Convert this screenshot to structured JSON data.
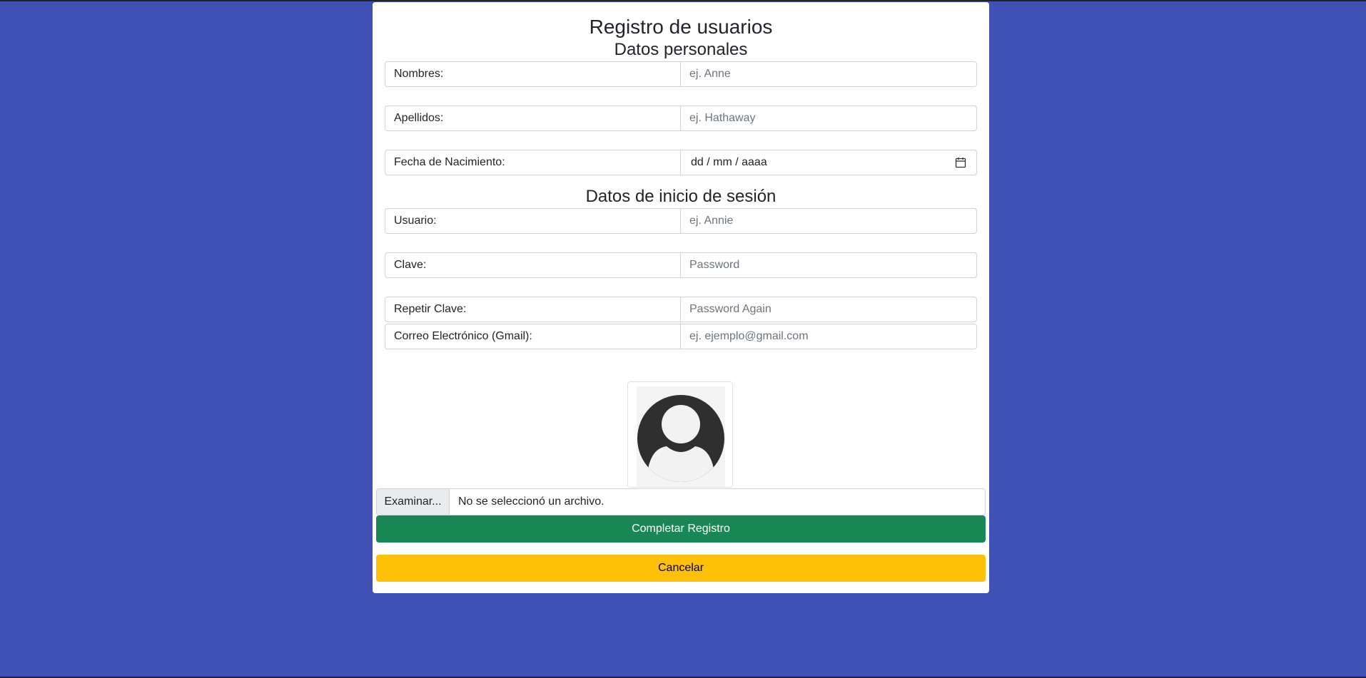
{
  "form": {
    "title": "Registro de usuarios",
    "section_personal": "Datos personales",
    "section_login": "Datos de inicio de sesión",
    "fields": {
      "nombres": {
        "label": "Nombres:",
        "placeholder": "ej. Anne",
        "value": ""
      },
      "apellidos": {
        "label": "Apellidos:",
        "placeholder": "ej. Hathaway",
        "value": ""
      },
      "fecha": {
        "label": "Fecha de Nacimiento:",
        "format": "dd / mm / aaaa"
      },
      "usuario": {
        "label": "Usuario:",
        "placeholder": "ej. Annie",
        "value": ""
      },
      "clave": {
        "label": "Clave:",
        "placeholder": "Password",
        "value": ""
      },
      "repetir_clave": {
        "label": "Repetir Clave:",
        "placeholder": "Password Again",
        "value": ""
      },
      "correo": {
        "label": "Correo Electrónico (Gmail):",
        "placeholder": "ej. ejemplo@gmail.com",
        "value": ""
      }
    },
    "avatar": {
      "icon": "user-avatar-icon"
    },
    "file": {
      "button_label": "Examinar...",
      "status": "No se seleccionó un archivo."
    },
    "buttons": {
      "submit": "Completar Registro",
      "cancel": "Cancelar"
    }
  },
  "colors": {
    "background": "#3f51b5",
    "success": "#198754",
    "warning": "#ffc107"
  }
}
